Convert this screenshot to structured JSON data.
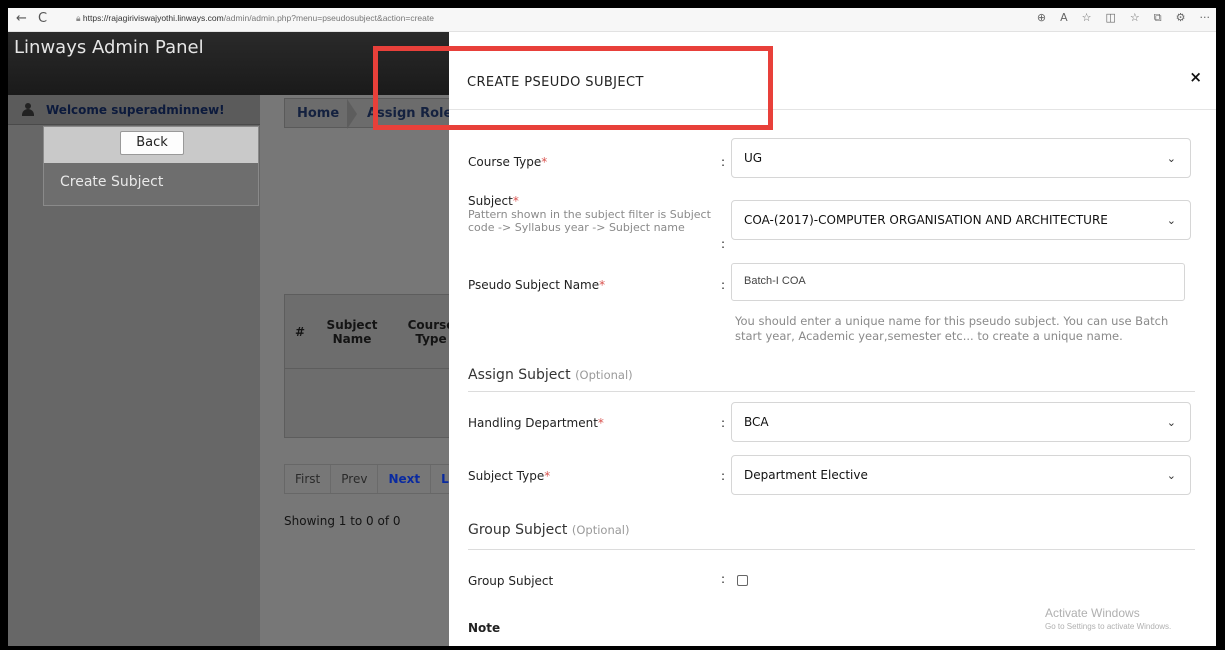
{
  "browser": {
    "back_glyph": "←",
    "refresh_glyph": "C",
    "url_host": "https://rajagiriviswajyothi.linways.com",
    "url_path": "/admin/admin.php?menu=pseudosubject&action=create",
    "right_icons": [
      "⊕",
      "A",
      "☆",
      "◫",
      "☆",
      "⧉",
      "⚙",
      "···"
    ]
  },
  "app": {
    "title": "Linways Admin Panel",
    "welcome": "Welcome superadminnew!"
  },
  "sidebar": {
    "back_label": "Back",
    "create_subject": "Create Subject"
  },
  "breadcrumb": {
    "home": "Home",
    "current": "Assign Roles"
  },
  "table": {
    "headers": [
      "#",
      "Subject Name",
      "Course Type"
    ]
  },
  "pager": {
    "first": "First",
    "prev": "Prev",
    "next": "Next",
    "last": "L"
  },
  "showing": "Showing 1 to 0 of 0",
  "modal": {
    "title": "CREATE PSEUDO SUBJECT",
    "close": "×",
    "course_type": {
      "label": "Course Type",
      "req": "*",
      "value": "UG"
    },
    "subject": {
      "label": "Subject",
      "req": "*",
      "hint": "Pattern shown in the subject filter is Subject code -> Syllabus year -> Subject name",
      "value": "COA-(2017)-COMPUTER ORGANISATION AND ARCHITECTURE"
    },
    "pseudo_name": {
      "label": "Pseudo Subject Name",
      "req": "*",
      "value": "Batch-I COA",
      "help": "You should enter a unique name for this pseudo subject. You can use Batch start year, Academic year,semester etc... to create a unique name."
    },
    "assign_section": {
      "title": "Assign Subject",
      "optional": "(Optional)"
    },
    "handling_dept": {
      "label": "Handling Department",
      "req": "*",
      "value": "BCA"
    },
    "subject_type": {
      "label": "Subject Type",
      "req": "*",
      "value": "Department Elective"
    },
    "group_section": {
      "title": "Group Subject",
      "optional": "(Optional)"
    },
    "group_subject": {
      "label": "Group Subject",
      "checked": false
    },
    "note": "Note",
    "colon": ":"
  },
  "watermark": {
    "line1": "Activate Windows",
    "line2": "Go to Settings to activate Windows."
  },
  "colors": {
    "highlight": "#e8403a",
    "required": "#d9534f"
  }
}
